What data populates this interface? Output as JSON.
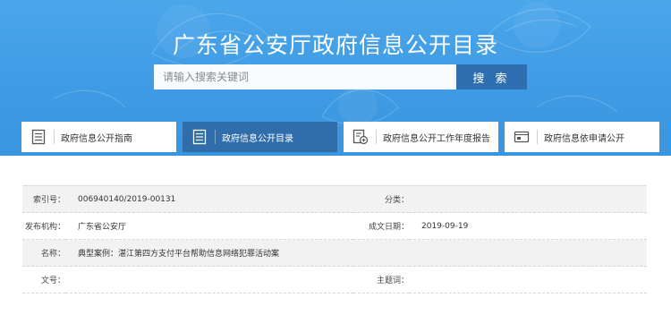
{
  "header": {
    "title": "广东省公安厅政府信息公开目录"
  },
  "search": {
    "placeholder": "请输入搜索关键词",
    "button_label": "搜 索"
  },
  "tabs": [
    {
      "label": "政府信息公开指南",
      "icon": "document-list-icon",
      "active": false
    },
    {
      "label": "政府信息公开目录",
      "icon": "catalog-icon",
      "active": true
    },
    {
      "label": "政府信息公开工作年度报告",
      "icon": "report-icon",
      "active": false
    },
    {
      "label": "政府信息依申请公开",
      "icon": "application-icon",
      "active": false
    }
  ],
  "info": {
    "index_no_label": "索引号：",
    "index_no_value": "006940140/2019-00131",
    "category_label": "分类：",
    "category_value": "",
    "publisher_label": "发布机构：",
    "publisher_value": "广东省公安厅",
    "date_label": "成文日期：",
    "date_value": "2019-09-19",
    "name_label": "名称：",
    "name_value": "典型案例：湛江第四方支付平台帮助信息网络犯罪活动案",
    "doc_no_label": "文号：",
    "doc_no_value": "",
    "subject_label": "主题词：",
    "subject_value": ""
  },
  "colors": {
    "banner": "#3f9be4",
    "active_tab": "#2f6dab",
    "search_button": "#2d6fb1"
  }
}
